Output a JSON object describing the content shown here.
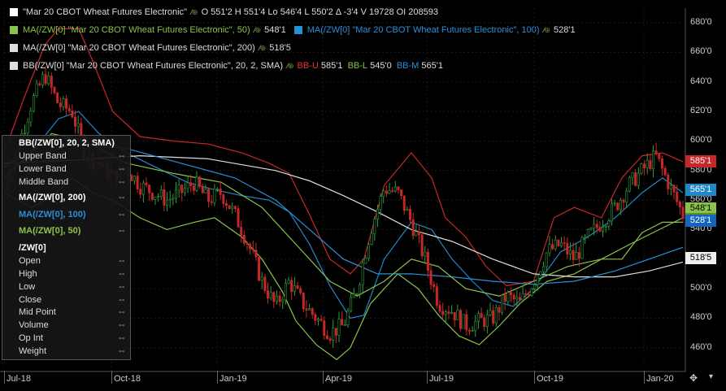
{
  "instrument": {
    "name": "\"Mar 20 CBOT Wheat Futures Electronic\"",
    "ohlc": "O 551'2  H 551'4  Lo 546'4  L 550'2  Δ -3'4  V 19728  OI 208593",
    "color": "#ffffff"
  },
  "studies": [
    {
      "label": "MA(/ZW[0] \"Mar 20 CBOT Wheat Futures Electronic\", 50)",
      "value": "548'1",
      "color": "#8bc34a"
    },
    {
      "label": "MA(/ZW[0] \"Mar 20 CBOT Wheat Futures Electronic\", 100)",
      "value": "528'1",
      "color": "#2b8fd6"
    },
    {
      "label": "MA(/ZW[0] \"Mar 20 CBOT Wheat Futures Electronic\", 200)",
      "value": "518'5",
      "color": "#dddddd"
    },
    {
      "label": "BB(/ZW[0] \"Mar 20 CBOT Wheat Futures Electronic\", 20, 2, SMA)",
      "color": "#dddddd"
    }
  ],
  "bb_values": {
    "upper_label": "BB-U",
    "upper": "585'1",
    "lower_label": "BB-L",
    "lower": "545'0",
    "middle_label": "BB-M",
    "middle": "565'1"
  },
  "input_glyph": "⁄⁄⊕",
  "y_axis": {
    "ticks": [
      "680'0",
      "660'0",
      "640'0",
      "620'0",
      "600'0",
      "580'0",
      "560'0",
      "540'0",
      "520'0",
      "500'0",
      "480'0",
      "460'0"
    ]
  },
  "price_tags": [
    {
      "text": "585'1",
      "bg": "#c62828",
      "fg": "#ffffff"
    },
    {
      "text": "565'1",
      "bg": "#1e88c8",
      "fg": "#ffffff"
    },
    {
      "text": "548'1",
      "bg": "#8bc34a",
      "fg": "#000000"
    },
    {
      "text": "545'0",
      "bg": "#5b8f2a",
      "fg": "#000000"
    },
    {
      "text": "528'1",
      "bg": "#1565c0",
      "fg": "#ffffff"
    },
    {
      "text": "518'5",
      "bg": "#eeeeee",
      "fg": "#000000"
    }
  ],
  "x_axis": {
    "labels": [
      "Jul-18",
      "Oct-18",
      "Jan-19",
      "Apr-19",
      "Jul-19",
      "Oct-19",
      "Jan-20"
    ]
  },
  "data_window": {
    "bb_title": "BB(/ZW[0], 20, 2, SMA)",
    "bb_rows": [
      "Upper Band",
      "Lower Band",
      "Middle Band"
    ],
    "ma200": "MA(/ZW[0], 200)",
    "ma100": "MA(/ZW[0], 100)",
    "ma50": "MA(/ZW[0], 50)",
    "sym": "/ZW[0]",
    "rows": [
      "Open",
      "High",
      "Low",
      "Close",
      "Mid Point",
      "Volume",
      "Op Int",
      "Weight"
    ],
    "placeholder": "--"
  },
  "corner": {
    "icon": "move-icon"
  },
  "chart_data": {
    "type": "line",
    "title": "Mar 20 CBOT Wheat Futures Electronic",
    "ylim": [
      445,
      690
    ],
    "x_range": [
      "2018-07-01",
      "2020-02-20"
    ],
    "series": [
      {
        "name": "BB-U",
        "color": "#c62828",
        "points": [
          [
            0,
            592
          ],
          [
            0.03,
            630
          ],
          [
            0.06,
            665
          ],
          [
            0.08,
            676
          ],
          [
            0.11,
            676
          ],
          [
            0.13,
            655
          ],
          [
            0.16,
            620
          ],
          [
            0.2,
            603
          ],
          [
            0.25,
            600
          ],
          [
            0.3,
            598
          ],
          [
            0.35,
            592
          ],
          [
            0.39,
            585
          ],
          [
            0.42,
            578
          ],
          [
            0.45,
            550
          ],
          [
            0.48,
            520
          ],
          [
            0.51,
            510
          ],
          [
            0.53,
            520
          ],
          [
            0.56,
            570
          ],
          [
            0.6,
            592
          ],
          [
            0.63,
            575
          ],
          [
            0.65,
            548
          ],
          [
            0.68,
            535
          ],
          [
            0.71,
            515
          ],
          [
            0.74,
            502
          ],
          [
            0.78,
            505
          ],
          [
            0.81,
            548
          ],
          [
            0.84,
            555
          ],
          [
            0.88,
            548
          ],
          [
            0.91,
            575
          ],
          [
            0.94,
            590
          ],
          [
            0.97,
            592
          ],
          [
            1,
            586
          ]
        ]
      },
      {
        "name": "BB-M",
        "color": "#1e88c8",
        "points": [
          [
            0,
            583
          ],
          [
            0.04,
            592
          ],
          [
            0.08,
            615
          ],
          [
            0.11,
            620
          ],
          [
            0.14,
            605
          ],
          [
            0.18,
            592
          ],
          [
            0.22,
            583
          ],
          [
            0.27,
            572
          ],
          [
            0.31,
            567
          ],
          [
            0.35,
            563
          ],
          [
            0.39,
            560
          ],
          [
            0.42,
            552
          ],
          [
            0.45,
            530
          ],
          [
            0.48,
            502
          ],
          [
            0.51,
            480
          ],
          [
            0.53,
            482
          ],
          [
            0.56,
            520
          ],
          [
            0.6,
            545
          ],
          [
            0.63,
            540
          ],
          [
            0.66,
            520
          ],
          [
            0.69,
            505
          ],
          [
            0.72,
            492
          ],
          [
            0.75,
            488
          ],
          [
            0.78,
            500
          ],
          [
            0.82,
            525
          ],
          [
            0.86,
            535
          ],
          [
            0.9,
            548
          ],
          [
            0.94,
            565
          ],
          [
            0.97,
            575
          ],
          [
            1,
            565
          ]
        ]
      },
      {
        "name": "BB-L",
        "color": "#8bc34a",
        "points": [
          [
            0,
            565
          ],
          [
            0.04,
            555
          ],
          [
            0.07,
            562
          ],
          [
            0.1,
            575
          ],
          [
            0.13,
            565
          ],
          [
            0.16,
            560
          ],
          [
            0.2,
            548
          ],
          [
            0.24,
            540
          ],
          [
            0.28,
            545
          ],
          [
            0.31,
            548
          ],
          [
            0.35,
            535
          ],
          [
            0.38,
            520
          ],
          [
            0.41,
            498
          ],
          [
            0.43,
            478
          ],
          [
            0.46,
            462
          ],
          [
            0.49,
            452
          ],
          [
            0.51,
            460
          ],
          [
            0.54,
            490
          ],
          [
            0.58,
            510
          ],
          [
            0.61,
            500
          ],
          [
            0.64,
            482
          ],
          [
            0.67,
            468
          ],
          [
            0.7,
            462
          ],
          [
            0.73,
            475
          ],
          [
            0.76,
            490
          ],
          [
            0.8,
            505
          ],
          [
            0.84,
            510
          ],
          [
            0.88,
            520
          ],
          [
            0.91,
            520
          ],
          [
            0.94,
            538
          ],
          [
            0.97,
            545
          ],
          [
            1,
            545
          ]
        ]
      },
      {
        "name": "MA 200",
        "color": "#dddddd",
        "points": [
          [
            0,
            585
          ],
          [
            0.1,
            587
          ],
          [
            0.2,
            590
          ],
          [
            0.3,
            588
          ],
          [
            0.4,
            580
          ],
          [
            0.45,
            573
          ],
          [
            0.5,
            563
          ],
          [
            0.55,
            552
          ],
          [
            0.6,
            540
          ],
          [
            0.66,
            532
          ],
          [
            0.72,
            520
          ],
          [
            0.78,
            510
          ],
          [
            0.84,
            508
          ],
          [
            0.9,
            508
          ],
          [
            0.95,
            512
          ],
          [
            1,
            518
          ]
        ]
      },
      {
        "name": "MA 100",
        "color": "#2b8fd6",
        "points": [
          [
            0,
            582
          ],
          [
            0.1,
            598
          ],
          [
            0.18,
            595
          ],
          [
            0.26,
            585
          ],
          [
            0.34,
            575
          ],
          [
            0.4,
            560
          ],
          [
            0.45,
            540
          ],
          [
            0.5,
            520
          ],
          [
            0.55,
            510
          ],
          [
            0.6,
            510
          ],
          [
            0.66,
            508
          ],
          [
            0.72,
            505
          ],
          [
            0.78,
            503
          ],
          [
            0.84,
            505
          ],
          [
            0.9,
            512
          ],
          [
            0.95,
            520
          ],
          [
            1,
            528
          ]
        ]
      },
      {
        "name": "MA 50",
        "color": "#8bc34a",
        "points": [
          [
            0,
            575
          ],
          [
            0.07,
            605
          ],
          [
            0.12,
            600
          ],
          [
            0.18,
            585
          ],
          [
            0.25,
            578
          ],
          [
            0.32,
            572
          ],
          [
            0.38,
            555
          ],
          [
            0.43,
            530
          ],
          [
            0.48,
            505
          ],
          [
            0.52,
            495
          ],
          [
            0.56,
            505
          ],
          [
            0.6,
            520
          ],
          [
            0.64,
            515
          ],
          [
            0.68,
            500
          ],
          [
            0.73,
            495
          ],
          [
            0.78,
            505
          ],
          [
            0.83,
            515
          ],
          [
            0.88,
            520
          ],
          [
            0.93,
            532
          ],
          [
            1,
            548
          ]
        ]
      }
    ],
    "price_path": [
      [
        0,
        570
      ],
      [
        0.02,
        595
      ],
      [
        0.04,
        625
      ],
      [
        0.06,
        645
      ],
      [
        0.08,
        625
      ],
      [
        0.1,
        620
      ],
      [
        0.12,
        590
      ],
      [
        0.14,
        585
      ],
      [
        0.16,
        575
      ],
      [
        0.18,
        582
      ],
      [
        0.2,
        570
      ],
      [
        0.22,
        565
      ],
      [
        0.24,
        560
      ],
      [
        0.26,
        565
      ],
      [
        0.28,
        572
      ],
      [
        0.3,
        560
      ],
      [
        0.32,
        565
      ],
      [
        0.34,
        550
      ],
      [
        0.36,
        530
      ],
      [
        0.38,
        505
      ],
      [
        0.4,
        488
      ],
      [
        0.42,
        505
      ],
      [
        0.44,
        490
      ],
      [
        0.46,
        480
      ],
      [
        0.48,
        470
      ],
      [
        0.5,
        475
      ],
      [
        0.52,
        500
      ],
      [
        0.54,
        540
      ],
      [
        0.56,
        568
      ],
      [
        0.58,
        565
      ],
      [
        0.6,
        545
      ],
      [
        0.62,
        520
      ],
      [
        0.64,
        490
      ],
      [
        0.66,
        485
      ],
      [
        0.68,
        475
      ],
      [
        0.7,
        478
      ],
      [
        0.72,
        480
      ],
      [
        0.74,
        495
      ],
      [
        0.76,
        490
      ],
      [
        0.78,
        505
      ],
      [
        0.8,
        525
      ],
      [
        0.82,
        530
      ],
      [
        0.84,
        520
      ],
      [
        0.86,
        535
      ],
      [
        0.88,
        545
      ],
      [
        0.9,
        555
      ],
      [
        0.92,
        570
      ],
      [
        0.94,
        580
      ],
      [
        0.96,
        590
      ],
      [
        0.98,
        570
      ],
      [
        1,
        550
      ]
    ]
  }
}
